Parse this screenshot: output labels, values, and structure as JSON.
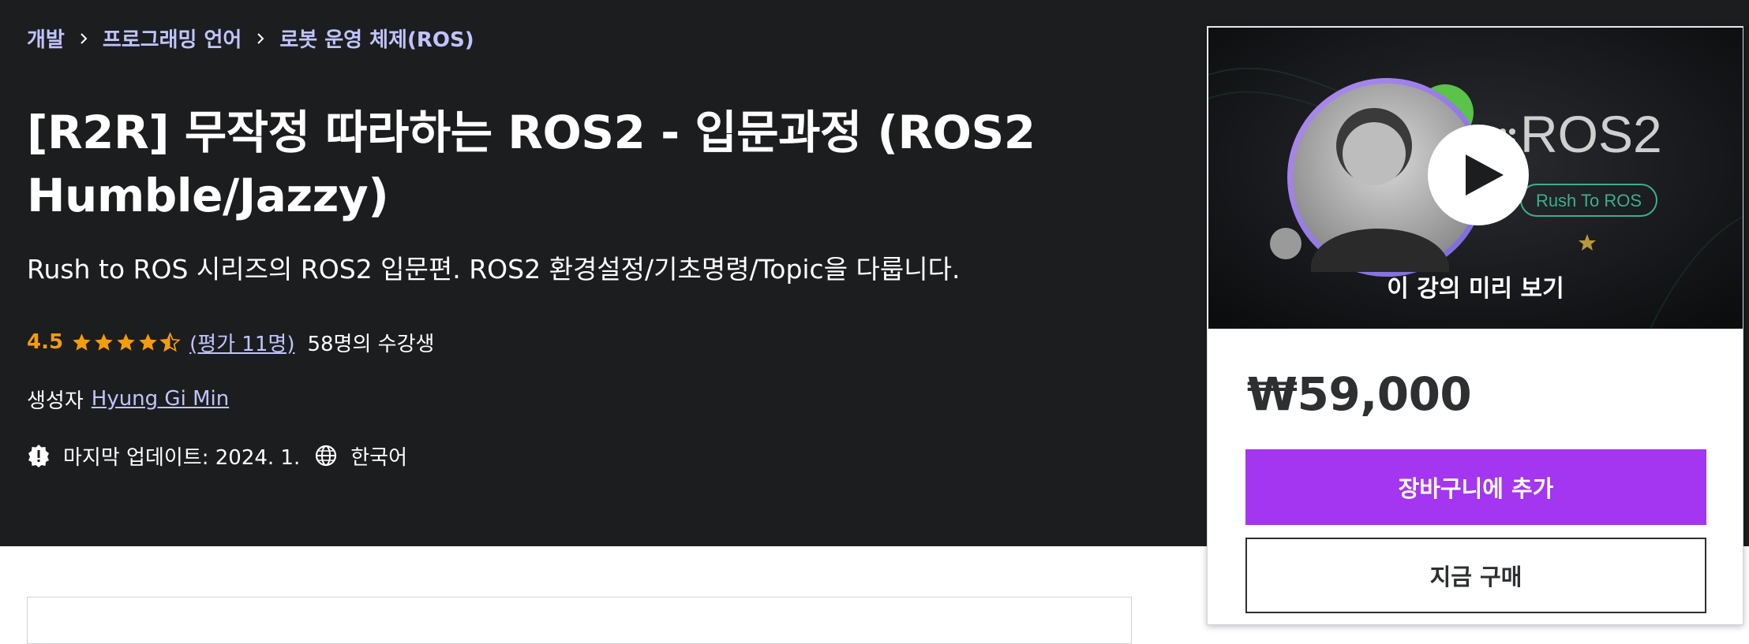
{
  "breadcrumb": {
    "items": [
      "개발",
      "프로그래밍 언어",
      "로봇 운영 체제(ROS)"
    ]
  },
  "course": {
    "title": "[R2R] 무작정 따라하는 ROS2 - 입문과정 (ROS2 Humble/Jazzy)",
    "subtitle": "Rush to ROS 시리즈의 ROS2 입문편. ROS2 환경설정/기초명령/Topic을 다룹니다.",
    "rating_value": "4.5",
    "rating_count_link": "(평가 11명)",
    "students": "58명의 수강생",
    "creator_label": "생성자",
    "creator_name": "Hyung Gi Min",
    "last_updated": "마지막 업데이트: 2024. 1.",
    "language": "한국어",
    "stars": 4.5
  },
  "sidebar": {
    "preview_logo": "ROS2",
    "preview_badge": "Rush To ROS",
    "preview_label": "이 강의 미리 보기",
    "price": "₩59,000",
    "add_to_cart": "장바구니에 추가",
    "buy_now": "지금 구매"
  },
  "colors": {
    "hero_bg": "#1c1d1f",
    "accent_link": "#c0c4fc",
    "rating": "#f69c08",
    "cart_button": "#a435f0"
  }
}
